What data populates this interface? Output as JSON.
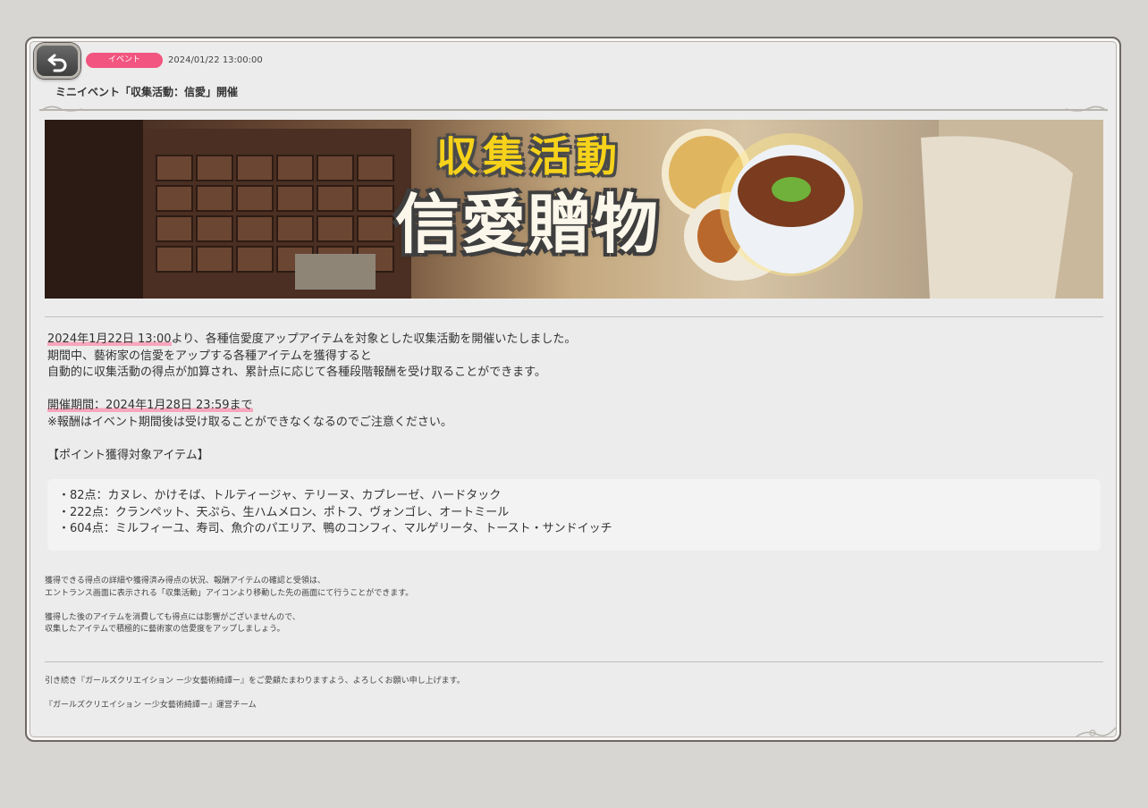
{
  "header": {
    "badge_label": "イベント",
    "date": "2024/01/22 13:00:00",
    "title": "ミニイベント「収集活動：信愛」開催"
  },
  "banner": {
    "headline_small": "収集活動",
    "headline_large": "信愛贈物"
  },
  "body": {
    "line1_highlight": "2024年1月22日 13:00",
    "line1_rest": "より、各種信愛度アップアイテムを対象とした収集活動を開催いたしました。",
    "line2": "期間中、藝術家の信愛をアップする各種アイテムを獲得すると",
    "line3": "自動的に収集活動の得点が加算され、累計点に応じて各種段階報酬を受け取ることができます。",
    "period_highlight": "開催期間：2024年1月28日 23:59まで",
    "period_note": "※報酬はイベント期間後は受け取ることができなくなるのでご注意ください。",
    "items_heading": "【ポイント獲得対象アイテム】"
  },
  "items": [
    "・82点：カヌレ、かけそば、トルティージャ、テリーヌ、カプレーゼ、ハードタック",
    "・222点：クランペット、天ぷら、生ハムメロン、ポトフ、ヴォンゴレ、オートミール",
    "・604点：ミルフィーユ、寿司、魚介のパエリア、鴨のコンフィ、マルゲリータ、トースト・サンドイッチ"
  ],
  "notes": {
    "n1": "獲得できる得点の詳細や獲得済み得点の状況、報酬アイテムの確認と受領は、",
    "n2": "エントランス画面に表示される「収集活動」アイコンより移動した先の画面にて行うことができます。",
    "n3": "獲得した後のアイテムを消費しても得点には影響がございませんので、",
    "n4": "収集したアイテムで積極的に藝術家の信愛度をアップしましょう。"
  },
  "footer": {
    "f1": "引き続き『ガールズクリエイション ー少女藝術綺譚ー』をご愛顧たまわりますよう、よろしくお願い申し上げます。",
    "f2": "『ガールズクリエイション ー少女藝術綺譚ー』運営チーム"
  },
  "colors": {
    "badge": "#f2557f",
    "highlight": "#f7a6bd",
    "headline_small": "#f6d21a"
  },
  "icons": {
    "back": "return-arrow-icon"
  }
}
